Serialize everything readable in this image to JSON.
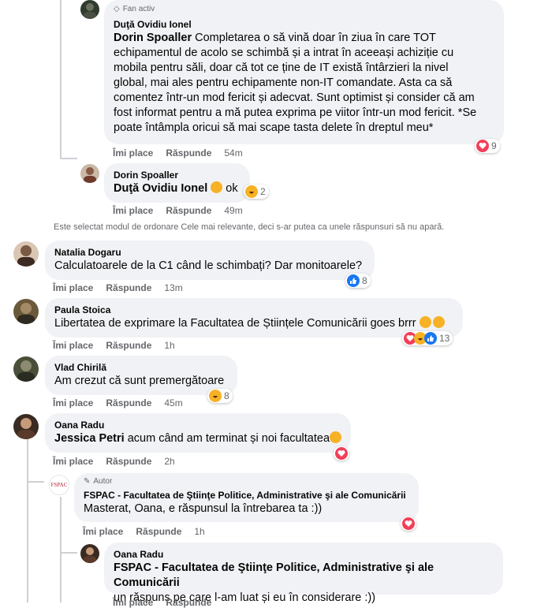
{
  "colors": {
    "accent": "#1877f2",
    "love": "#f33e58",
    "haha": "#f7b125",
    "bubble": "#f0f2f5",
    "meta": "#65676b"
  },
  "actions": {
    "like": "Îmi place",
    "reply": "Răspunde"
  },
  "notice": "Este selectat modul de ordonare Cele mai relevante, deci s-ar putea ca unele răspunsuri să nu apară.",
  "c1": {
    "badge": "Fan activ",
    "author": "Duţă Ovidiu Ionel",
    "mention": "Dorin Spoaller",
    "lines": [
      " Completarea o să vină doar în ziua în care TOT",
      "echipamentul de acolo se schimbă și a intrat în aceeași achiziție cu",
      "mobila pentru săli, doar că tot ce ține de IT există întârzieri la nivel",
      "global, mai ales pentru echipamente non-IT comandate. Asta ca să",
      "comentez într-un mod fericit și adecvat. Sunt optimist și consider că am",
      "fost informat pentru a mă putea exprima pe viitor într-un mod fericit. *Se",
      "poate întâmpla oricui să mai scape tasta delete în dreptul meu*"
    ],
    "time": "54m",
    "reactions": "9"
  },
  "c2": {
    "author": "Dorin Spoaller",
    "mention": "Duţă Ovidiu Ionel",
    "text": " ok",
    "time": "49m",
    "reactions": "2"
  },
  "c3": {
    "author": "Natalia Dogaru",
    "text": "Calculatoarele de la C1 când le schimbați? Dar monitoarele?",
    "time": "13m",
    "reactions": "8"
  },
  "c4": {
    "author": "Paula Stoica",
    "text": "Libertatea de exprimare la Facultatea de Științele Comunicării goes brrr",
    "time": "1h",
    "reactions": "13"
  },
  "c5": {
    "author": "Vlad Chirilă",
    "text": "Am crezut că sunt premergătoare",
    "time": "45m",
    "reactions": "8"
  },
  "c6": {
    "author": "Oana Radu",
    "mention": "Jessica Petri",
    "text": " acum când am terminat și noi facultatea",
    "time": "2h"
  },
  "c7": {
    "badge": "Autor",
    "author": "FSPAC - Facultatea de Ştiinţe Politice, Administrative şi ale Comunicării",
    "text": "Masterat, Oana, e răspunsul la întrebarea ta :))",
    "time": "1h",
    "logo": "FSPAC"
  },
  "c8": {
    "author": "Oana Radu",
    "mention": "FSPAC - Facultatea de Ştiinţe Politice, Administrative şi ale Comunicării",
    "text": "un răspuns pe care l-am luat și eu în considerare :))"
  }
}
